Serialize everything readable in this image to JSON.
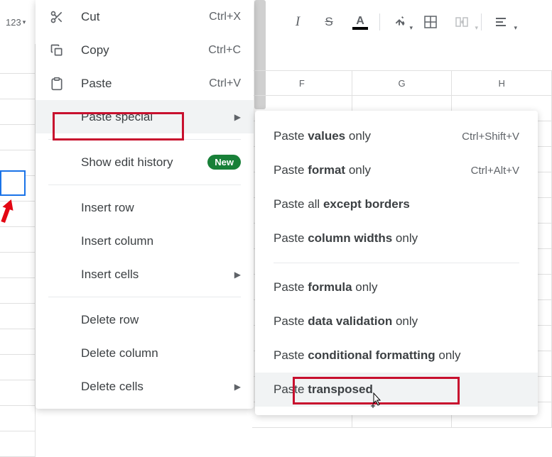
{
  "toolbar": {
    "format_123": "123",
    "italic": "I",
    "strike": "S",
    "text_color_letter": "A"
  },
  "columns": [
    "F",
    "G",
    "H"
  ],
  "context_menu": {
    "cut": {
      "label": "Cut",
      "shortcut": "Ctrl+X"
    },
    "copy": {
      "label": "Copy",
      "shortcut": "Ctrl+C"
    },
    "paste": {
      "label": "Paste",
      "shortcut": "Ctrl+V"
    },
    "paste_special": {
      "label": "Paste special"
    },
    "show_edit_history": {
      "label": "Show edit history",
      "badge": "New"
    },
    "insert_row": {
      "label": "Insert row"
    },
    "insert_column": {
      "label": "Insert column"
    },
    "insert_cells": {
      "label": "Insert cells"
    },
    "delete_row": {
      "label": "Delete row"
    },
    "delete_column": {
      "label": "Delete column"
    },
    "delete_cells": {
      "label": "Delete cells"
    }
  },
  "submenu": {
    "values": {
      "prefix": "Paste ",
      "bold": "values",
      "suffix": " only",
      "shortcut": "Ctrl+Shift+V"
    },
    "format": {
      "prefix": "Paste ",
      "bold": "format",
      "suffix": " only",
      "shortcut": "Ctrl+Alt+V"
    },
    "except_borders": {
      "prefix": "Paste all ",
      "bold": "except borders",
      "suffix": ""
    },
    "column_widths": {
      "prefix": "Paste ",
      "bold": "column widths",
      "suffix": " only"
    },
    "formula": {
      "prefix": "Paste ",
      "bold": "formula",
      "suffix": " only"
    },
    "data_validation": {
      "prefix": "Paste ",
      "bold": "data validation",
      "suffix": " only"
    },
    "conditional": {
      "prefix": "Paste ",
      "bold": "conditional formatting",
      "suffix": " only"
    },
    "transposed": {
      "prefix": "Paste ",
      "bold": "transposed",
      "suffix": ""
    }
  }
}
